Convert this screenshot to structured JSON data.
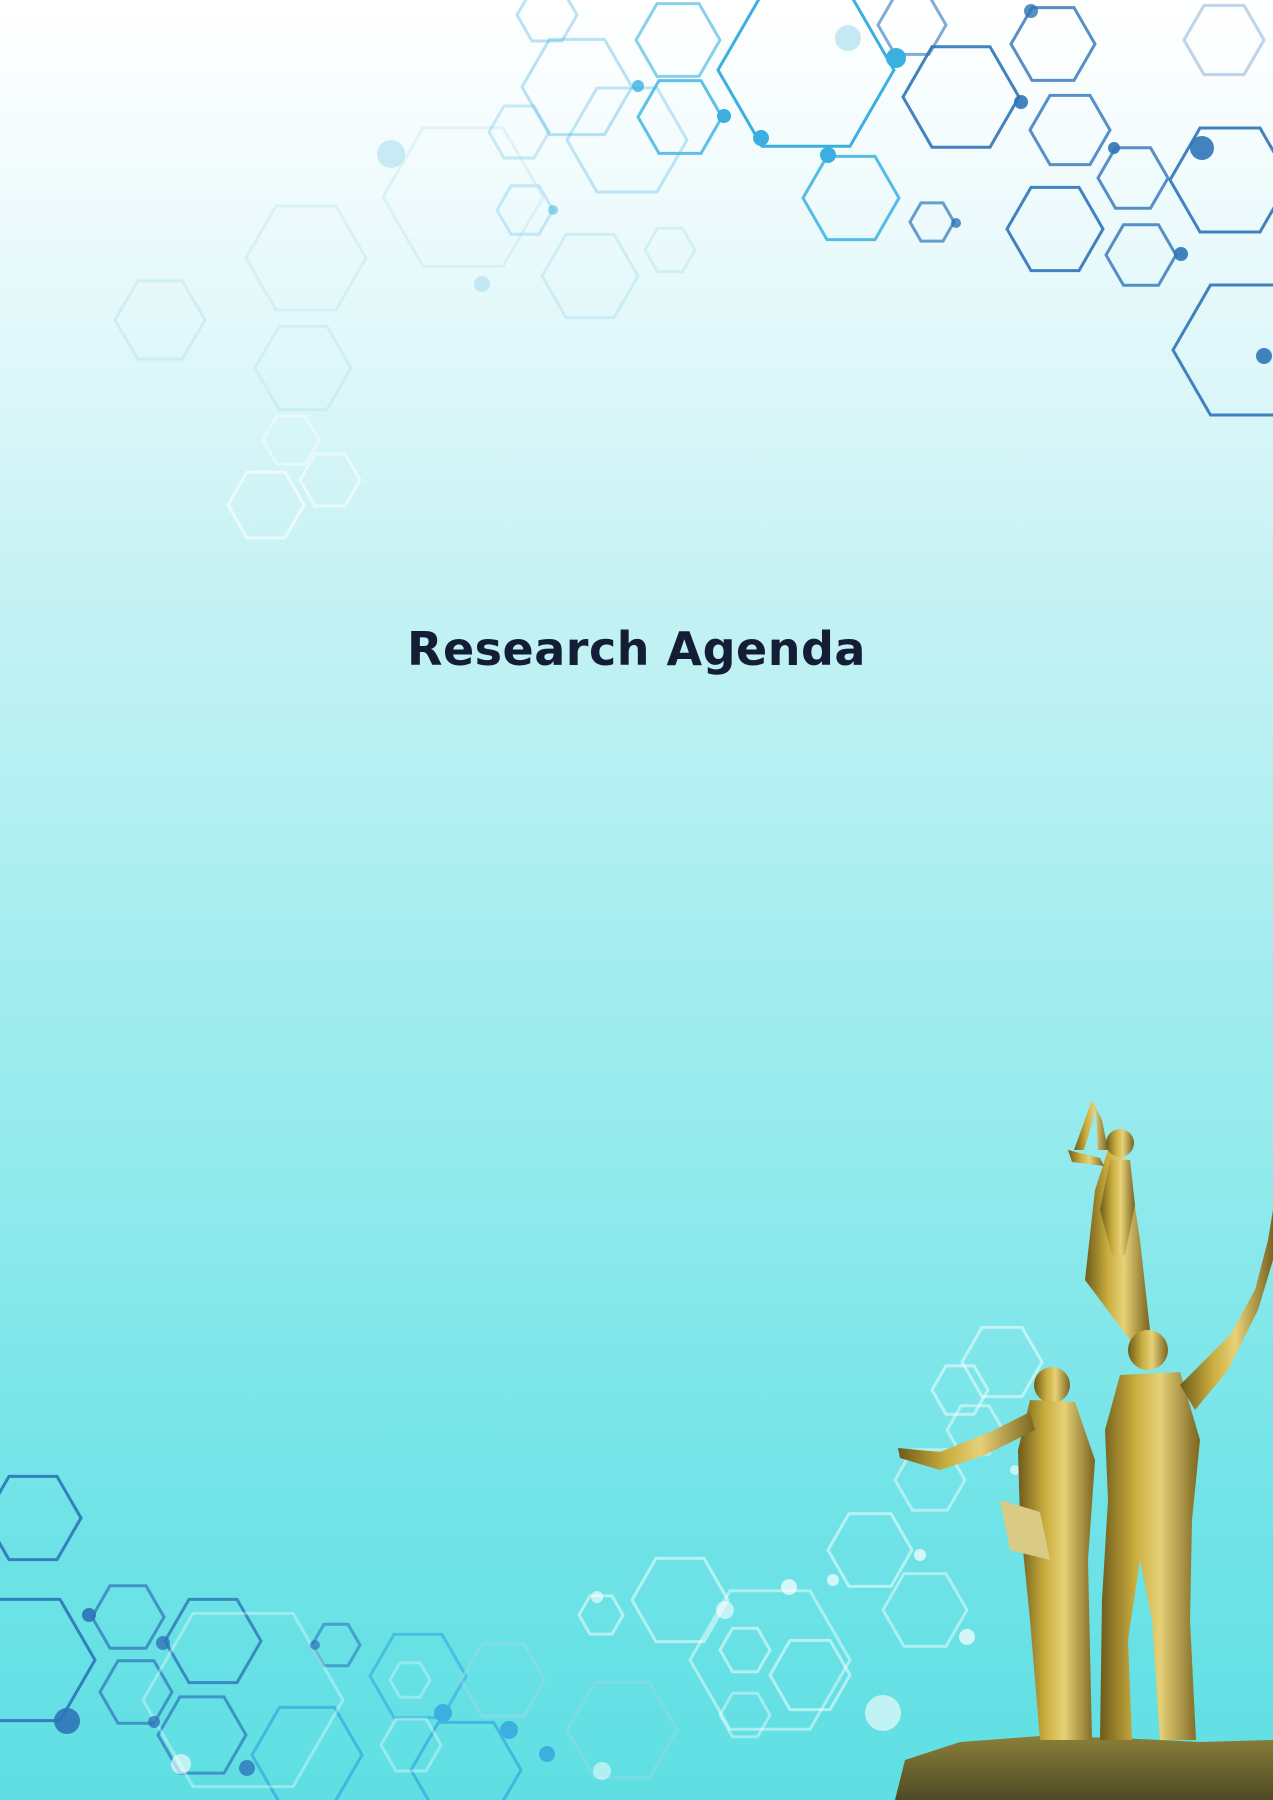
{
  "document": {
    "title": "Research Agenda"
  },
  "decorations": {
    "top_pattern": "hexagon-network-icon",
    "bottom_pattern": "hexagon-network-icon",
    "statue": "golden-monument-statue"
  },
  "colors": {
    "title": "#141d36",
    "hex_dark": "#2e74b8",
    "hex_mid": "#3bb0e0",
    "hex_light": "#9ed8ec",
    "gold": "#b89a2e"
  }
}
